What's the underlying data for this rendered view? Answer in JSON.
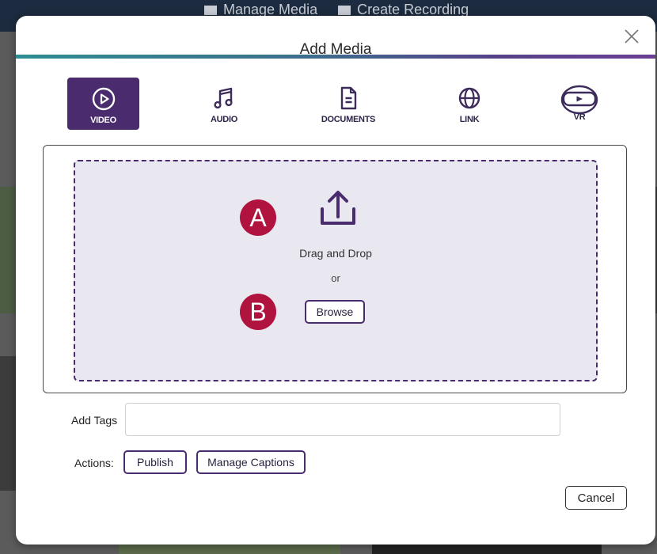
{
  "background": {
    "nav_items": [
      {
        "icon": "film-icon",
        "label": "Manage Media"
      },
      {
        "icon": "camera-icon",
        "label": "Create Recording"
      }
    ]
  },
  "modal": {
    "title": "Add Media",
    "media_types": [
      {
        "label": "VIDEO",
        "icon": "play-circle-icon",
        "selected": true
      },
      {
        "label": "AUDIO",
        "icon": "music-note-icon",
        "selected": false
      },
      {
        "label": "DOCUMENTS",
        "icon": "document-icon",
        "selected": false
      },
      {
        "label": "LINK",
        "icon": "globe-icon",
        "selected": false
      },
      {
        "label": "VR",
        "icon": "vr-headset-icon",
        "selected": false
      }
    ],
    "upload": {
      "drag_text": "Drag and Drop",
      "or_text": "or",
      "browse_label": "Browse",
      "marker_a": "A",
      "marker_b": "B"
    },
    "tags": {
      "label": "Add Tags",
      "value": ""
    },
    "actions": {
      "label": "Actions:",
      "publish_label": "Publish",
      "manage_captions_label": "Manage Captions"
    },
    "cancel_label": "Cancel"
  },
  "colors": {
    "accent": "#4a2c6e",
    "marker": "#b0133e",
    "dropzone_bg": "#e9e7f0"
  }
}
